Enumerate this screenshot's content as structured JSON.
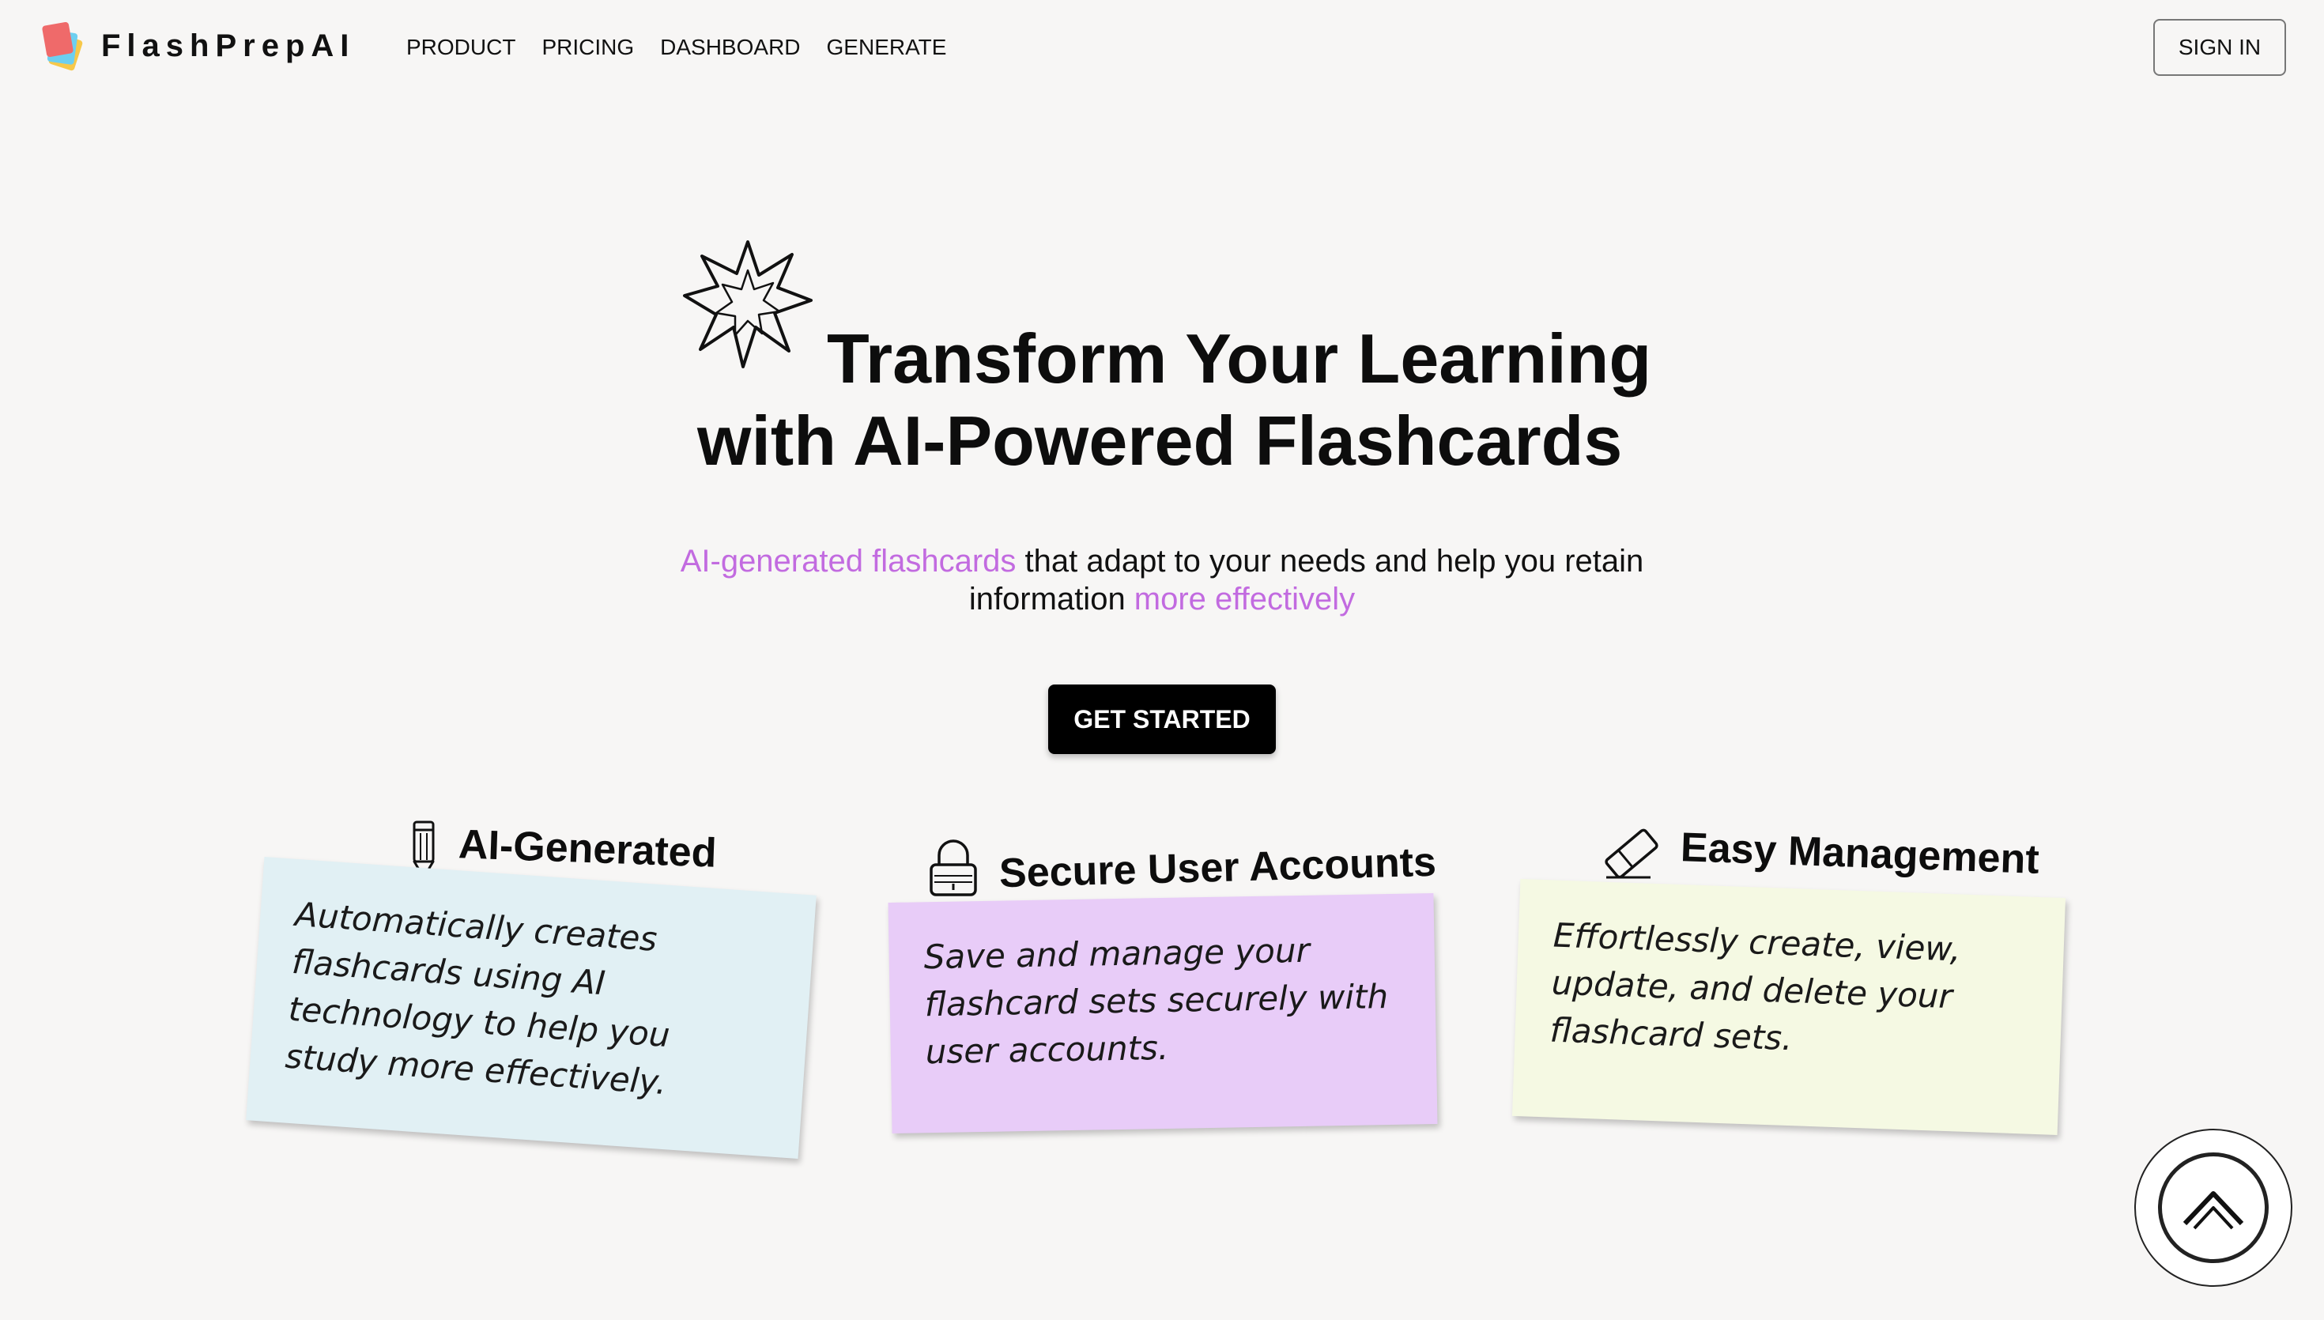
{
  "nav": {
    "brand": "FlashPrepAI",
    "links": [
      "PRODUCT",
      "PRICING",
      "DASHBOARD",
      "GENERATE"
    ],
    "sign_in": "SIGN IN",
    "logo_icon": "stacked-cards-logo"
  },
  "hero": {
    "title_line1": "Transform Your Learning",
    "title_line2": "with AI-Powered Flashcards",
    "subtitle": {
      "part1_accent": "AI-generated flashcards",
      "part2": " that adapt to your needs and help you retain information ",
      "part3_accent": "more effectively"
    },
    "cta": "GET STARTED",
    "star_icon": "sparkle-star-icon"
  },
  "features": [
    {
      "title": "AI-Generated",
      "icon": "pencil-icon",
      "text": "Automatically creates flashcards using AI technology to help you study more effectively."
    },
    {
      "title": "Secure User Accounts",
      "icon": "lock-icon",
      "text": "Save and manage your flashcard sets securely with user accounts."
    },
    {
      "title": "Easy Management",
      "icon": "eraser-icon",
      "text": "Effortlessly create, view, update, and delete your flashcard sets."
    }
  ],
  "colors": {
    "background": "#f7f6f5",
    "accent": "#c26be0",
    "card1": "#e1f0f4",
    "card2": "#e8ccf8",
    "card3": "#f5f9e3",
    "cta_bg": "#000000"
  },
  "scroll_top_icon": "chevron-up-icon"
}
